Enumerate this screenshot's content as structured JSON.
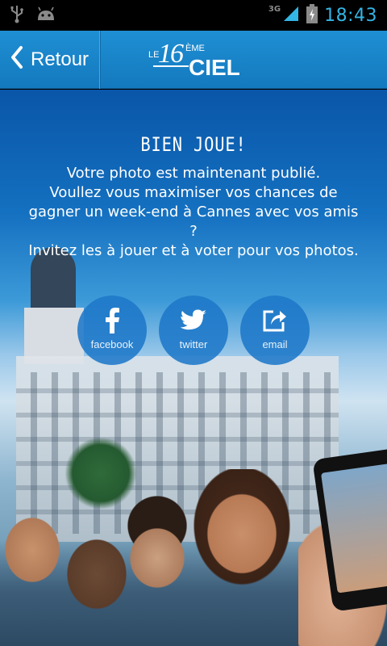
{
  "status_bar": {
    "time": "18:43",
    "network": "3G",
    "icons": [
      "usb-icon",
      "android-icon",
      "signal-icon",
      "battery-charging-icon"
    ]
  },
  "header": {
    "back_label": "Retour",
    "logo": {
      "prefix": "LE",
      "number": "16",
      "superscript": "ÈME",
      "word": "CIEL"
    }
  },
  "main": {
    "title": "BIEN JOUE!",
    "message_lines": [
      "Votre photo est maintenant publié.",
      "Voullez vous maximiser vos chances de",
      "gagner un week-end à Cannes avec vos amis",
      "?",
      "Invitez les à jouer et à voter pour vos photos."
    ]
  },
  "share": [
    {
      "label": "facebook",
      "icon": "facebook-icon"
    },
    {
      "label": "twitter",
      "icon": "twitter-bird-icon"
    },
    {
      "label": "email",
      "icon": "share-export-icon"
    }
  ],
  "colors": {
    "header_blue": "#1a86cc",
    "status_time": "#33b5e5",
    "share_button": "#1e78c8"
  }
}
